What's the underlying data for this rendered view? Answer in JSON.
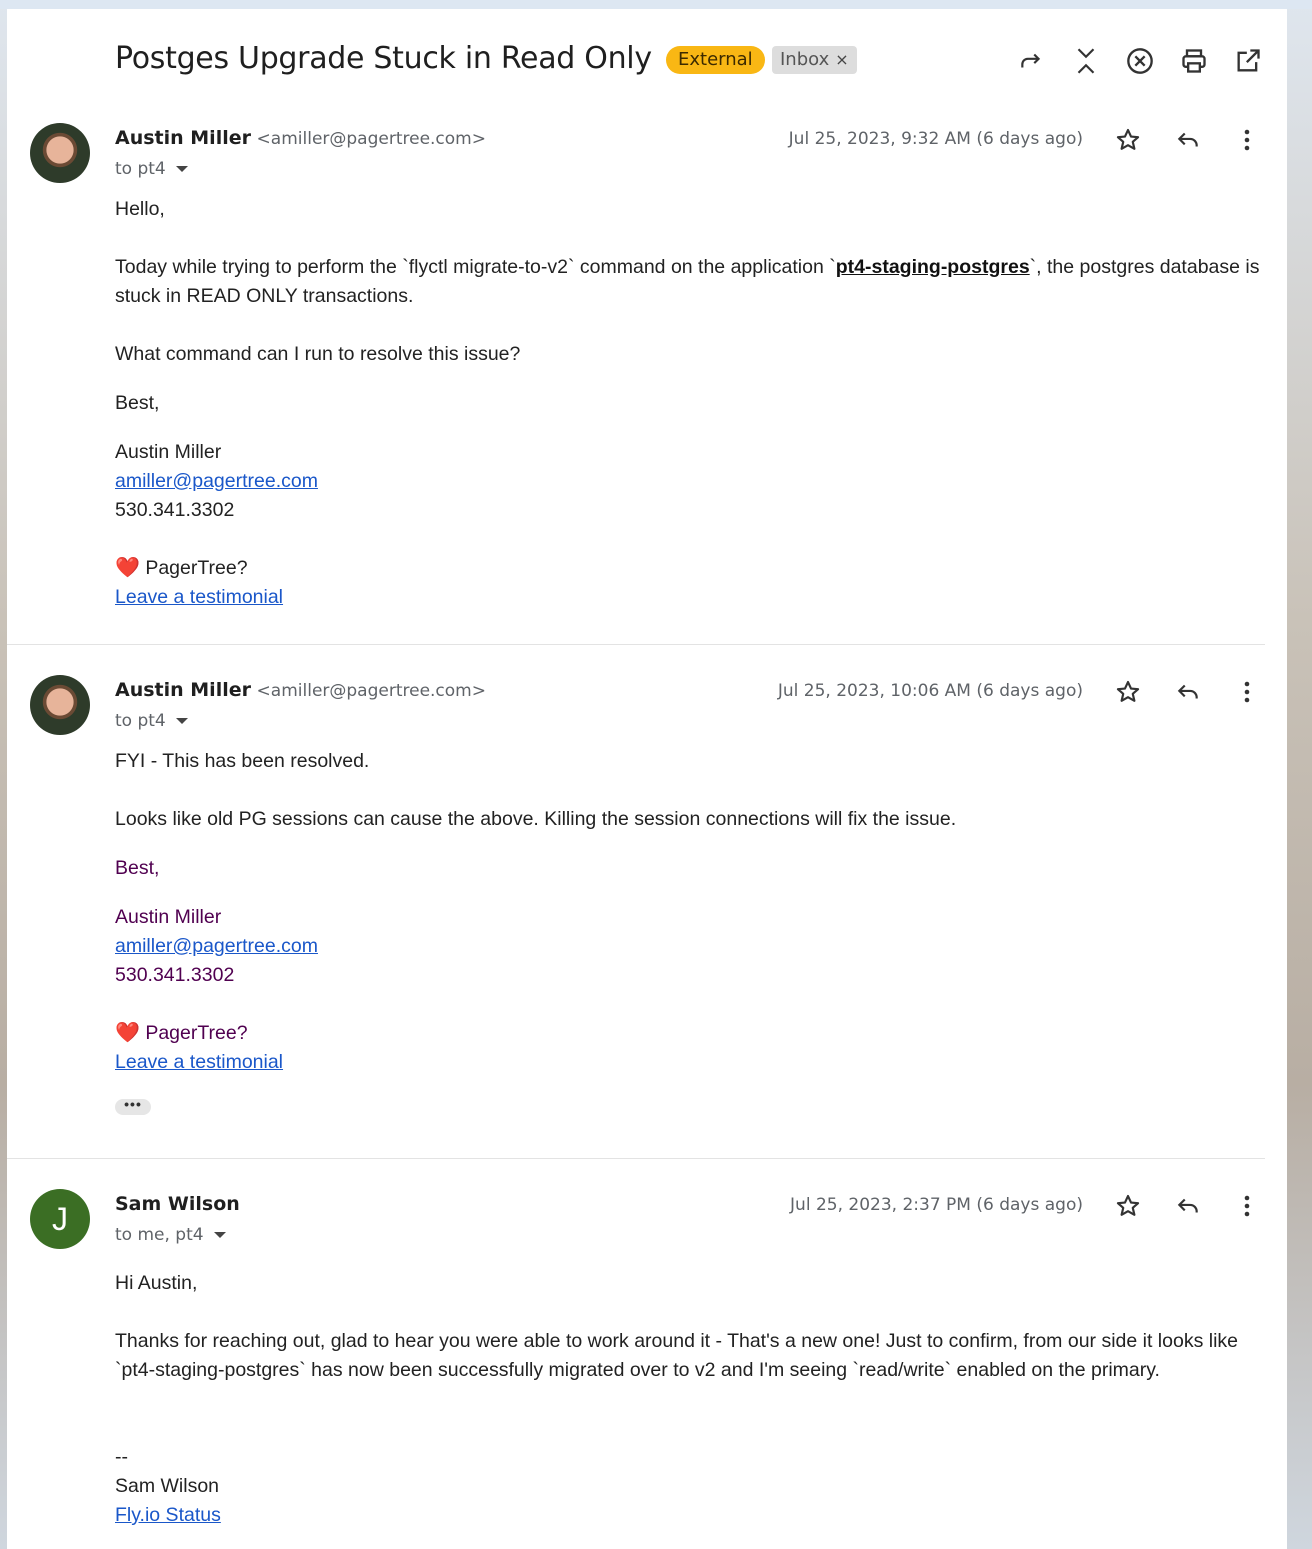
{
  "thread": {
    "subject": "Postges Upgrade Stuck in Read Only",
    "labels": {
      "external": "External",
      "inbox": "Inbox",
      "remove": "×"
    },
    "header_icons": [
      "forward-all-icon",
      "collapse-icon",
      "close-circle-icon",
      "print-icon",
      "open-new-window-icon"
    ]
  },
  "messages": [
    {
      "sender_name": "Austin Miller",
      "sender_email": "<amiller@pagertree.com>",
      "recipients": "to pt4",
      "date": "Jul 25, 2023, 9:32 AM (6 days ago)",
      "body": {
        "greeting": "Hello,",
        "p1_before": "Today while trying to perform the `flyctl migrate-to-v2` command on the application `",
        "p1_code": "pt4-staging-postgres",
        "p1_after": "`, the postgres database is stuck in READ ONLY transactions.",
        "p2": "What command can I run to resolve this issue?",
        "closing": "Best,",
        "sig_name": "Austin Miller",
        "sig_email": "amiller@pagertree.com",
        "sig_phone": "530.341.3302",
        "heart": "❤️",
        "pagertree": "PagerTree?",
        "testimonial": "Leave a testimonial"
      }
    },
    {
      "sender_name": "Austin Miller",
      "sender_email": "<amiller@pagertree.com>",
      "recipients": "to pt4",
      "date": "Jul 25, 2023, 10:06 AM (6 days ago)",
      "body": {
        "p1": "FYI - This has been resolved.",
        "p2": "Looks like old PG sessions can cause the above. Killing the session connections will fix the issue.",
        "closing": "Best,",
        "sig_name": "Austin Miller",
        "sig_email": "amiller@pagertree.com",
        "sig_phone": "530.341.3302",
        "heart": "❤️",
        "pagertree": "PagerTree?",
        "testimonial": "Leave a testimonial",
        "ellipsis": "•••"
      }
    },
    {
      "sender_name": "Sam Wilson",
      "avatar_letter": "J",
      "recipients": "to me, pt4",
      "date": "Jul 25, 2023, 2:37 PM (6 days ago)",
      "body": {
        "greeting": "Hi Austin,",
        "p1": "Thanks for reaching out, glad to hear you were able to work around it - That's a new one! Just to confirm, from our side it looks like `pt4-staging-postgres` has now been successfully migrated over to v2 and I'm seeing `read/write` enabled on the primary.",
        "sig_dash": "--",
        "sig_name": "Sam Wilson",
        "status_link": "Fly.io Status"
      }
    }
  ],
  "colors": {
    "external_chip": "#f9b714",
    "avatar_j": "#3b6e24",
    "link": "#1a57c9",
    "quoted_text": "#500050"
  }
}
